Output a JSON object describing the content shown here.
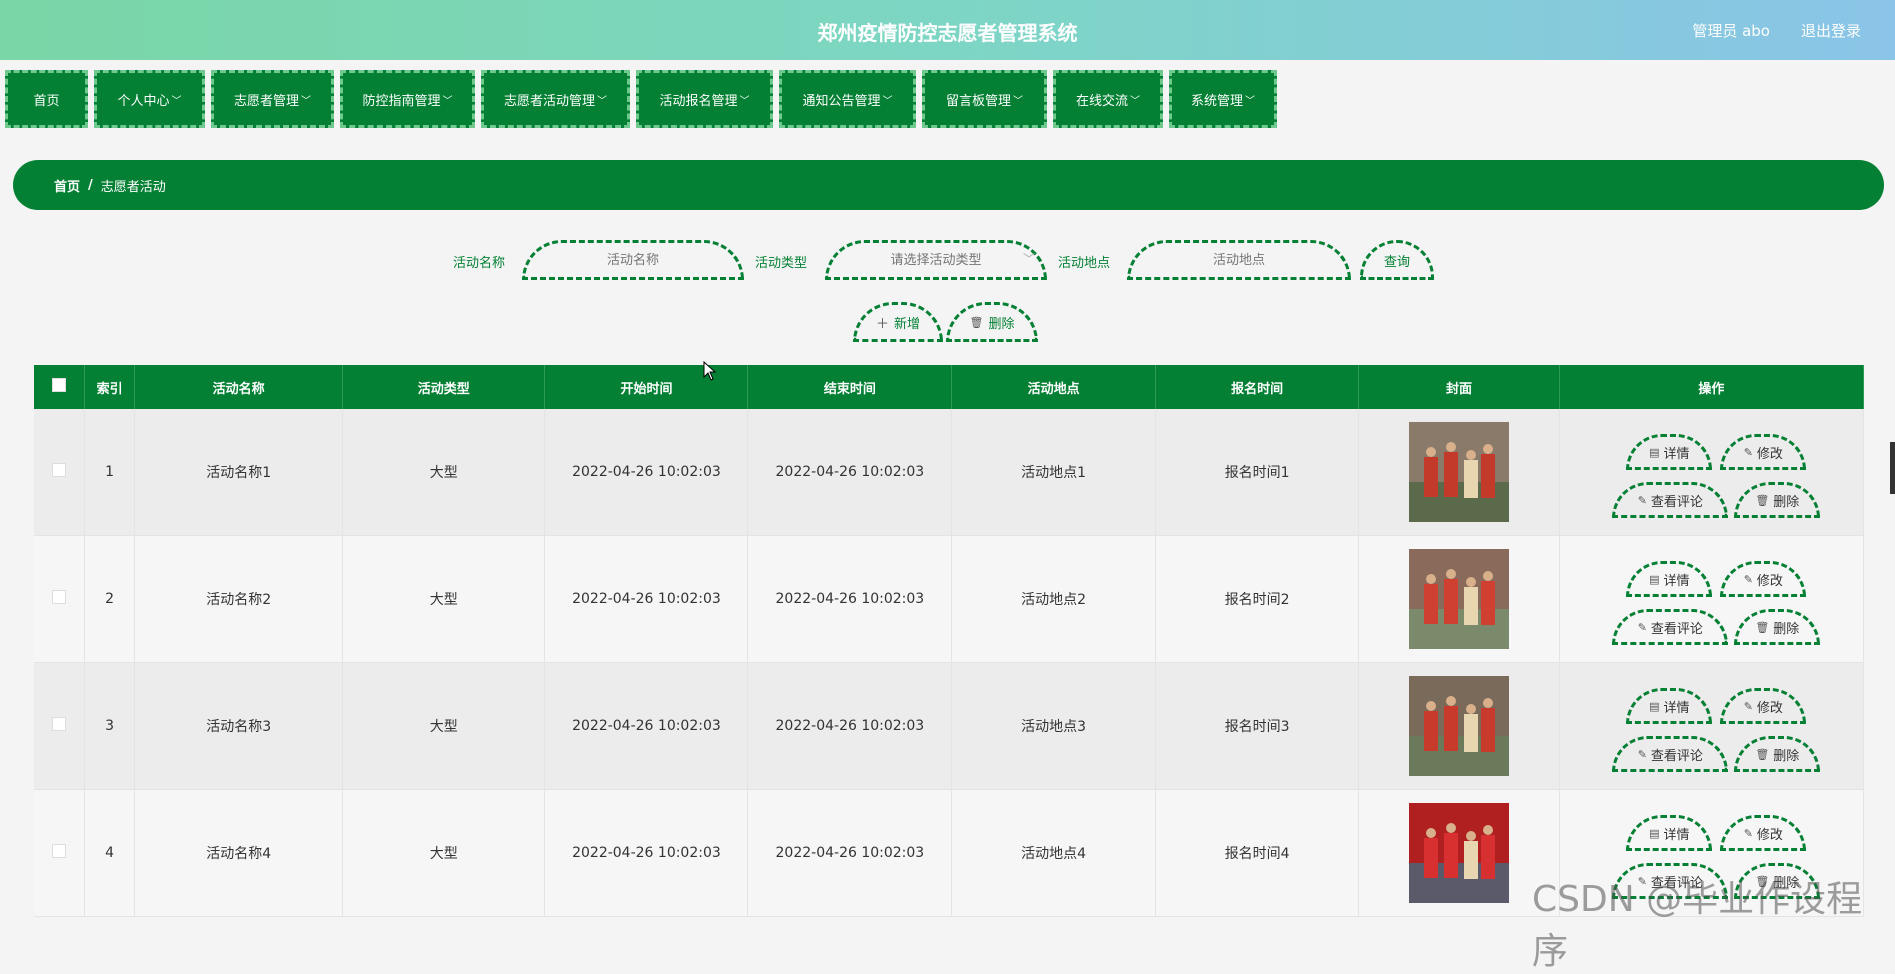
{
  "header": {
    "title": "郑州疫情防控志愿者管理系统",
    "admin": "管理员 abo",
    "logout": "退出登录"
  },
  "nav": [
    {
      "label": "首页",
      "dropdown": false
    },
    {
      "label": "个人中心",
      "dropdown": true
    },
    {
      "label": "志愿者管理",
      "dropdown": true
    },
    {
      "label": "防控指南管理",
      "dropdown": true
    },
    {
      "label": "志愿者活动管理",
      "dropdown": true
    },
    {
      "label": "活动报名管理",
      "dropdown": true
    },
    {
      "label": "通知公告管理",
      "dropdown": true
    },
    {
      "label": "留言板管理",
      "dropdown": true
    },
    {
      "label": "在线交流",
      "dropdown": true
    },
    {
      "label": "系统管理",
      "dropdown": true
    }
  ],
  "breadcrumb": {
    "home": "首页",
    "sep": "/",
    "current": "志愿者活动"
  },
  "search": {
    "name_label": "活动名称",
    "name_placeholder": "活动名称",
    "type_label": "活动类型",
    "type_placeholder": "请选择活动类型",
    "place_label": "活动地点",
    "place_placeholder": "活动地点",
    "query": "查询"
  },
  "actions": {
    "add": "新增",
    "delete": "删除"
  },
  "table": {
    "columns": [
      "索引",
      "活动名称",
      "活动类型",
      "开始时间",
      "结束时间",
      "活动地点",
      "报名时间",
      "封面",
      "操作"
    ],
    "rows": [
      {
        "index": "1",
        "name": "活动名称1",
        "type": "大型",
        "start": "2022-04-26 10:02:03",
        "end": "2022-04-26 10:02:03",
        "place": "活动地点1",
        "signup": "报名时间1"
      },
      {
        "index": "2",
        "name": "活动名称2",
        "type": "大型",
        "start": "2022-04-26 10:02:03",
        "end": "2022-04-26 10:02:03",
        "place": "活动地点2",
        "signup": "报名时间2"
      },
      {
        "index": "3",
        "name": "活动名称3",
        "type": "大型",
        "start": "2022-04-26 10:02:03",
        "end": "2022-04-26 10:02:03",
        "place": "活动地点3",
        "signup": "报名时间3"
      },
      {
        "index": "4",
        "name": "活动名称4",
        "type": "大型",
        "start": "2022-04-26 10:02:03",
        "end": "2022-04-26 10:02:03",
        "place": "活动地点4",
        "signup": "报名时间4"
      }
    ],
    "ops": {
      "detail": "详情",
      "edit": "修改",
      "comments": "查看评论",
      "delete": "删除"
    }
  },
  "watermark": "CSDN @毕业作设程序",
  "colors": {
    "primary": "#038033",
    "header_start": "#7ad6a6",
    "header_end": "#8ac4e8"
  }
}
